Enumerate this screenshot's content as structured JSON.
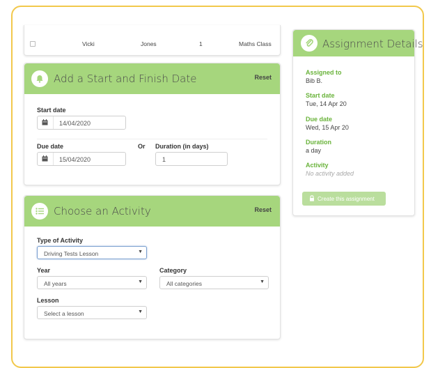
{
  "table_row": {
    "first_name": "Vicki",
    "last_name": "Jones",
    "count": "1",
    "class_name": "Maths Class"
  },
  "dates_card": {
    "title": "Add a Start and Finish Date",
    "reset": "Reset",
    "start_label": "Start date",
    "start_value": "14/04/2020",
    "due_label": "Due date",
    "due_value": "15/04/2020",
    "or_label": "Or",
    "duration_label": "Duration (in days)",
    "duration_value": "1"
  },
  "activity_card": {
    "title": "Choose an Activity",
    "reset": "Reset",
    "type_label": "Type of Activity",
    "type_value": "Driving Tests Lesson",
    "year_label": "Year",
    "year_value": "All years",
    "category_label": "Category",
    "category_value": "All categories",
    "lesson_label": "Lesson",
    "lesson_value": "Select a lesson"
  },
  "details": {
    "title": "Assignment Details",
    "assigned_label": "Assigned to",
    "assigned_value": "Bib B.",
    "start_label": "Start date",
    "start_value": "Tue, 14 Apr 20",
    "due_label": "Due date",
    "due_value": "Wed, 15 Apr 20",
    "duration_label": "Duration",
    "duration_value": "a day",
    "activity_label": "Activity",
    "activity_value": "No activity added",
    "create_button": "Create this assignment"
  },
  "colors": {
    "accent_green": "#a6d67d",
    "label_green": "#6ab33b",
    "frame_yellow": "#f2c84b"
  },
  "icons": [
    "bell-icon",
    "list-icon",
    "paperclip-icon",
    "calendar-icon",
    "lock-icon",
    "chevron-down-icon",
    "checkbox"
  ]
}
